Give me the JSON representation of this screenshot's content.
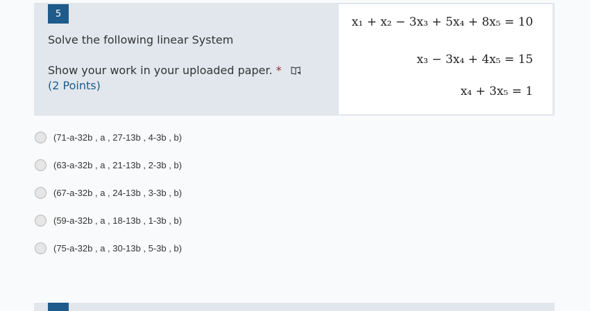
{
  "question": {
    "number": "5",
    "title": "Solve the following linear System",
    "instruction": "Show your work in your uploaded paper.",
    "required_mark": "*",
    "points": "(2 Points)",
    "reader_icon": "immersive-reader-icon"
  },
  "equations": [
    "x₁ + x₂ − 3x₃ + 5x₄ + 8x₅ = 10",
    "x₃ − 3x₄ + 4x₅ = 15",
    "x₄ + 3x₅ = 1"
  ],
  "options": [
    "(71-a-32b , a , 27-13b , 4-3b , b)",
    "(63-a-32b , a , 21-13b , 2-3b , b)",
    "(67-a-32b , a , 24-13b , 3-3b , b)",
    "(59-a-32b , a , 18-13b , 1-3b , b)",
    "(75-a-32b , a , 30-13b , 5-3b , b)"
  ],
  "colors": {
    "accent": "#1e5b8a",
    "header_bg": "#e1e7ed",
    "required": "#a4262c"
  }
}
